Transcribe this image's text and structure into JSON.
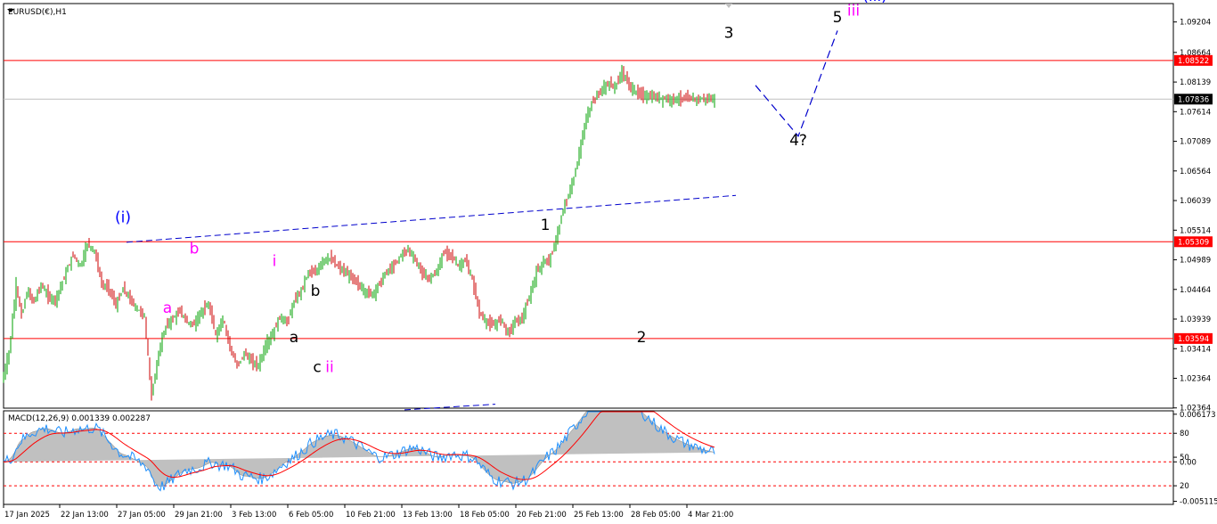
{
  "chart_data": [
    {
      "type": "line",
      "title": "EURUSD(€),H1",
      "price_axis_ticks": [
        "1.09204",
        "1.08664",
        "1.08139",
        "1.07614",
        "1.07089",
        "1.06564",
        "1.06039",
        "1.05514",
        "1.04989",
        "1.04464",
        "1.03939",
        "1.03414",
        "1.02364",
        "1.02364"
      ],
      "ylim": [
        1.0236,
        1.0953
      ],
      "horizontal_levels": [
        {
          "value": 1.08522,
          "label": "1.08522",
          "color": "#ff0000"
        },
        {
          "value": 1.05309,
          "label": "1.05309",
          "color": "#ff0000"
        },
        {
          "value": 1.03594,
          "label": "1.03594",
          "color": "#ff0000"
        },
        {
          "value": 1.07836,
          "label": "1.07836",
          "color": "#000000",
          "line_color": "#c0c0c0"
        }
      ],
      "x_ticks": [
        "17 Jan 2025",
        "22 Jan 13:00",
        "27 Jan 05:00",
        "29 Jan 21:00",
        "3 Feb 13:00",
        "6 Feb 05:00",
        "10 Feb 21:00",
        "13 Feb 13:00",
        "18 Feb 05:00",
        "20 Feb 21:00",
        "25 Feb 13:00",
        "28 Feb 05:00",
        "4 Mar 21:00"
      ],
      "price_path": {
        "x_index": [
          0,
          4,
          8,
          11,
          14,
          18,
          22,
          26,
          30,
          35,
          40,
          44,
          48,
          52,
          56,
          60,
          64,
          68,
          72,
          76,
          80,
          84,
          88,
          92,
          96,
          100,
          104,
          108,
          112,
          116,
          120,
          124,
          128,
          132,
          136,
          140,
          144,
          148,
          152,
          156,
          160,
          164,
          168,
          172,
          176,
          180,
          184,
          188,
          192,
          196,
          200,
          204,
          208,
          212,
          216,
          220,
          224,
          228,
          232,
          236,
          240,
          244,
          248,
          252,
          256,
          260,
          264,
          268,
          272,
          276,
          280,
          284,
          288,
          292,
          296,
          300,
          304,
          308,
          312,
          316,
          320,
          324,
          328,
          332,
          336,
          340,
          344,
          348,
          352,
          356,
          360,
          364,
          368,
          372,
          376,
          380,
          384,
          388,
          392,
          396,
          400,
          404
        ],
        "close": [
          1.0282,
          1.0335,
          1.0455,
          1.0398,
          1.0442,
          1.0425,
          1.0455,
          1.0433,
          1.0428,
          1.0468,
          1.0508,
          1.0488,
          1.0528,
          1.0515,
          1.0455,
          1.0448,
          1.0418,
          1.0448,
          1.0428,
          1.0412,
          1.0398,
          1.0255,
          1.0335,
          1.0382,
          1.0395,
          1.0408,
          1.0388,
          1.0385,
          1.0408,
          1.0418,
          1.0365,
          1.0395,
          1.0345,
          1.0308,
          1.0335,
          1.0318,
          1.0312,
          1.0348,
          1.0368,
          1.0398,
          1.0388,
          1.0425,
          1.0445,
          1.0478,
          1.0475,
          1.0498,
          1.0502,
          1.0488,
          1.0478,
          1.0468,
          1.0455,
          1.0442,
          1.0438,
          1.0458,
          1.0478,
          1.0488,
          1.0508,
          1.0518,
          1.0498,
          1.0475,
          1.0465,
          1.0478,
          1.0512,
          1.0508,
          1.0488,
          1.0498,
          1.0462,
          1.0405,
          1.0388,
          1.0382,
          1.0395,
          1.0368,
          1.039,
          1.0395,
          1.0432,
          1.0478,
          1.0495,
          1.0502,
          1.0548,
          1.0598,
          1.0632,
          1.0688,
          1.0752,
          1.0782,
          1.0798,
          1.0812,
          1.0805,
          1.0832,
          1.0808,
          1.0795,
          1.079,
          1.0788,
          1.0786,
          1.0785,
          1.0784,
          1.0784,
          1.0784,
          1.0784,
          1.0784,
          1.0784,
          1.0784
        ]
      },
      "wave_labels": [
        {
          "text": "(i)",
          "color": "#0000ff",
          "value": 1.0565,
          "x_index": 67
        },
        {
          "text": "b",
          "color": "#ff00ff",
          "value": 1.051,
          "x_index": 107
        },
        {
          "text": "a",
          "color": "#ff00ff",
          "value": 1.0405,
          "x_index": 92
        },
        {
          "text": "i",
          "color": "#ff00ff",
          "value": 1.0488,
          "x_index": 152
        },
        {
          "text": "b",
          "color": "#000000",
          "value": 1.0435,
          "x_index": 175
        },
        {
          "text": "a",
          "color": "#000000",
          "value": 1.0353,
          "x_index": 163
        },
        {
          "text": "c",
          "color": "#000000",
          "value": 1.03,
          "x_index": 176
        },
        {
          "text": "ii",
          "color": "#ff00ff",
          "value": 1.03,
          "x_index": 183
        },
        {
          "text": "1",
          "color": "#000000",
          "value": 1.0552,
          "x_index": 304
        },
        {
          "text": "2",
          "color": "#000000",
          "value": 1.0353,
          "x_index": 358
        },
        {
          "text": "3",
          "color": "#000000",
          "value": 1.0892,
          "x_index": 407
        },
        {
          "text": "4?",
          "color": "#000000",
          "value": 1.0702,
          "x_index": 446
        },
        {
          "text": "5",
          "color": "#000000",
          "value": 1.092,
          "x_index": 468
        },
        {
          "text": "iii",
          "color": "#ff00ff",
          "value": 1.0932,
          "x_index": 477
        },
        {
          "text": "(iii)",
          "color": "#0000ff",
          "value": 1.0958,
          "x_index": 489
        }
      ],
      "projection": {
        "x_index": [
          422,
          446,
          468
        ],
        "value": [
          1.0808,
          1.0718,
          1.0905
        ],
        "color": "#0000cc",
        "style": "dashed"
      },
      "trendlines": [
        {
          "x_index": [
            69,
            411
          ],
          "value": [
            1.053,
            1.0613
          ],
          "color": "#0000cc",
          "style": "dashed"
        },
        {
          "x_index": [
            225,
            276
          ],
          "value": [
            1.0233,
            1.0243
          ],
          "color": "#0000cc",
          "style": "dashed"
        }
      ]
    },
    {
      "type": "line",
      "title": "MACD(12,26,9) 0.001339 0.002287",
      "axis_ticks": [
        "0.006173",
        "80",
        "50",
        "0.00",
        "20",
        "-0.005115"
      ],
      "ylim": [
        -0.0054,
        0.0065
      ],
      "zero_value": 0.0,
      "overbought_value": 0.0037,
      "mid_value": 0.0,
      "oversold_value": -0.0031,
      "grey_histogram_color": "#c0c0c0",
      "signal_color": "#ff0000",
      "oscillator_color": "#1e90ff"
    }
  ]
}
